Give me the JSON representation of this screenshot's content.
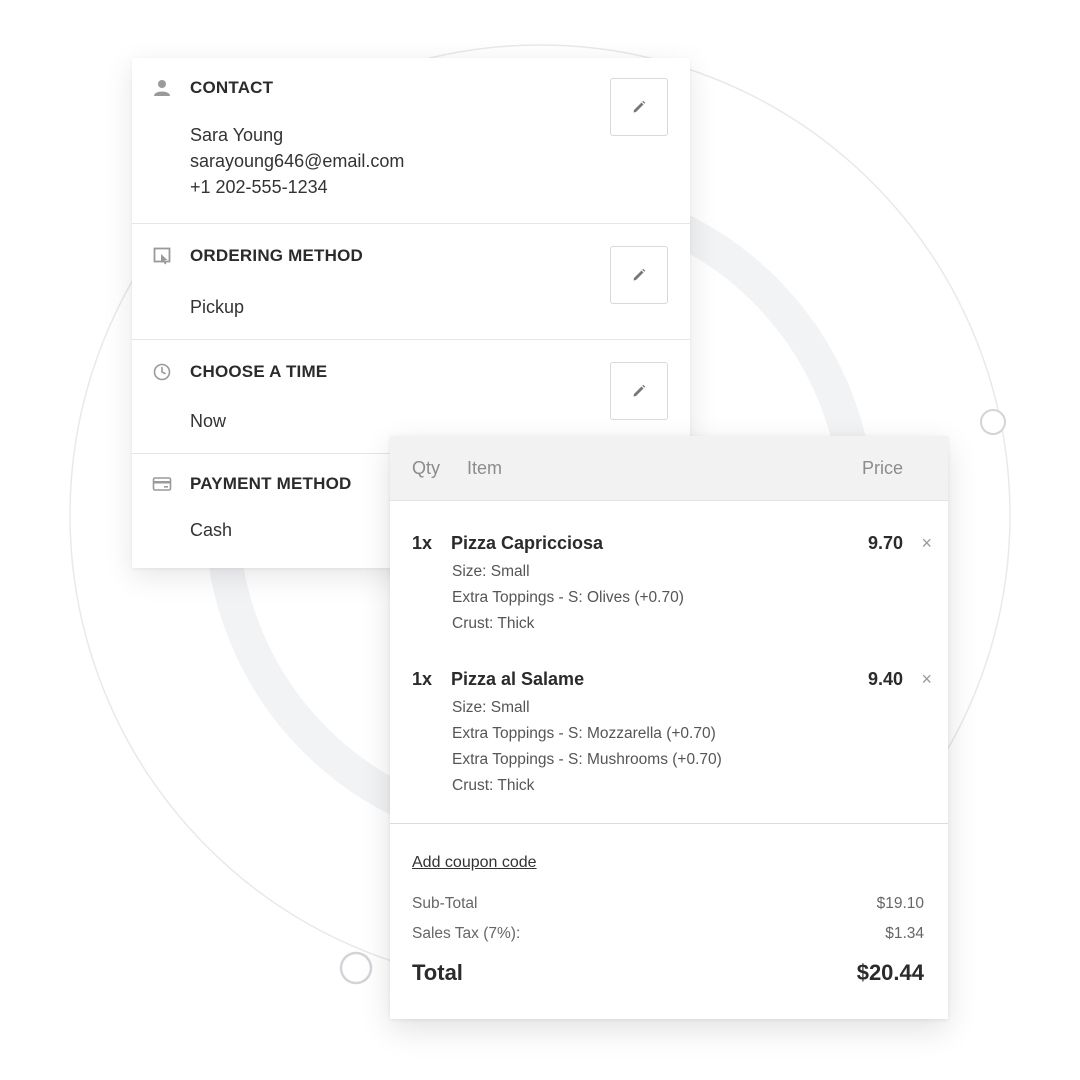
{
  "contact": {
    "title": "CONTACT",
    "name": "Sara Young",
    "email": "sarayoung646@email.com",
    "phone": "+1 202-555-1234",
    "icon": "person-icon"
  },
  "ordering_method": {
    "title": "ORDERING METHOD",
    "value": "Pickup",
    "icon": "ordering-icon"
  },
  "choose_time": {
    "title": "CHOOSE A TIME",
    "value": "Now",
    "icon": "clock-icon"
  },
  "payment_method": {
    "title": "PAYMENT METHOD",
    "value": "Cash",
    "icon": "credit-card-icon"
  },
  "edit_icon": "pencil-icon",
  "cart": {
    "headers": {
      "qty": "Qty",
      "item": "Item",
      "price": "Price"
    },
    "items": [
      {
        "qty": "1x",
        "name": "Pizza Capricciosa",
        "price": "9.70",
        "options": [
          "Size: Small",
          "Extra Toppings - S: Olives (+0.70)",
          "Crust: Thick"
        ]
      },
      {
        "qty": "1x",
        "name": "Pizza al Salame",
        "price": "9.40",
        "options": [
          "Size: Small",
          "Extra Toppings - S: Mozzarella (+0.70)",
          "Extra Toppings - S: Mushrooms (+0.70)",
          "Crust: Thick"
        ]
      }
    ],
    "remove_symbol": "×",
    "coupon_label": "Add coupon code",
    "subtotal_label": "Sub-Total",
    "subtotal_value": "$19.10",
    "tax_label": "Sales Tax (7%):",
    "tax_value": "$1.34",
    "total_label": "Total",
    "total_value": "$20.44"
  },
  "colors": {
    "background": "#ffffff",
    "decor_ring": "#f3f4f6",
    "icon_gray": "#9a9a9a",
    "header_bg": "#f2f2f2"
  }
}
